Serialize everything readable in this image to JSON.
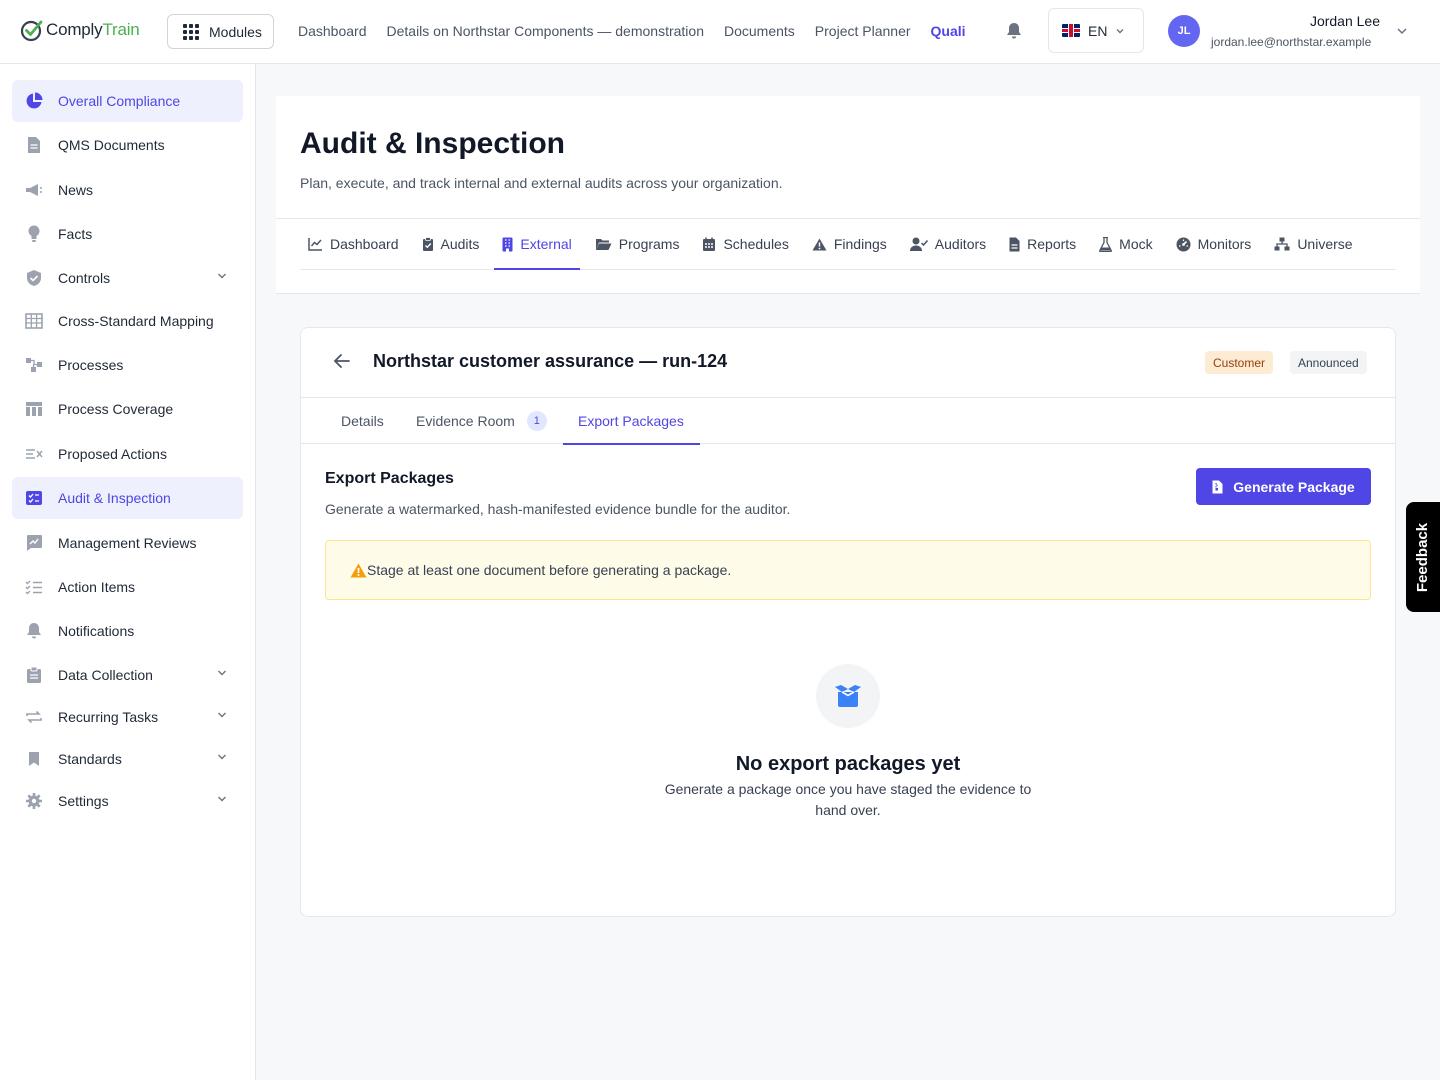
{
  "brand": {
    "name_part1": "Comply",
    "name_part2": "Train"
  },
  "topbar": {
    "modules_label": "Modules",
    "nav": [
      "Dashboard",
      "Details on Northstar Components — demonstration",
      "Documents",
      "Project Planner",
      "Quali"
    ],
    "active_nav": "Quali",
    "language": "EN",
    "user": {
      "initials": "JL",
      "name": "Jordan Lee",
      "email": "jordan.lee@northstar.example"
    }
  },
  "sidebar": {
    "items": [
      {
        "label": "Overall Compliance",
        "icon": "pie-chart-icon",
        "selected": true
      },
      {
        "label": "QMS Documents",
        "icon": "document-icon"
      },
      {
        "label": "News",
        "icon": "megaphone-icon"
      },
      {
        "label": "Facts",
        "icon": "lightbulb-icon"
      },
      {
        "label": "Controls",
        "icon": "shield-check-icon",
        "expandable": true
      },
      {
        "label": "Cross-Standard Mapping",
        "icon": "table-grid-icon"
      },
      {
        "label": "Processes",
        "icon": "process-flow-icon"
      },
      {
        "label": "Process Coverage",
        "icon": "table-columns-icon"
      },
      {
        "label": "Proposed Actions",
        "icon": "list-x-icon"
      },
      {
        "label": "Audit & Inspection",
        "icon": "clipboard-check-icon",
        "selected": true
      },
      {
        "label": "Management Reviews",
        "icon": "chart-comment-icon"
      },
      {
        "label": "Action Items",
        "icon": "checklist-icon"
      },
      {
        "label": "Notifications",
        "icon": "bell-icon"
      },
      {
        "label": "Data Collection",
        "icon": "clipboard-icon",
        "expandable": true
      },
      {
        "label": "Recurring Tasks",
        "icon": "repeat-icon",
        "expandable": true
      },
      {
        "label": "Standards",
        "icon": "bookmark-icon",
        "expandable": true
      },
      {
        "label": "Settings",
        "icon": "gear-icon",
        "expandable": true
      }
    ]
  },
  "page": {
    "title": "Audit & Inspection",
    "subtitle": "Plan, execute, and track internal and external audits across your organization.",
    "tabs": [
      {
        "label": "Dashboard",
        "icon": "line-chart-icon"
      },
      {
        "label": "Audits",
        "icon": "clipboard-check-icon"
      },
      {
        "label": "External",
        "icon": "building-icon",
        "selected": true
      },
      {
        "label": "Programs",
        "icon": "folder-open-icon"
      },
      {
        "label": "Schedules",
        "icon": "calendar-icon"
      },
      {
        "label": "Findings",
        "icon": "warning-icon"
      },
      {
        "label": "Auditors",
        "icon": "user-check-icon"
      },
      {
        "label": "Reports",
        "icon": "file-icon"
      },
      {
        "label": "Mock",
        "icon": "flask-icon"
      },
      {
        "label": "Monitors",
        "icon": "gauge-icon"
      },
      {
        "label": "Universe",
        "icon": "sitemap-icon"
      }
    ]
  },
  "audit": {
    "title": "Northstar customer assurance — run-124",
    "badges": {
      "type": "Customer",
      "status": "Announced"
    },
    "subtabs": {
      "details": "Details",
      "evidence": "Evidence Room",
      "evidence_count": "1",
      "export": "Export Packages"
    },
    "section_title": "Export Packages",
    "section_desc": "Generate a watermarked, hash-manifested evidence bundle for the auditor.",
    "generate_label": "Generate Package",
    "warning": "Stage at least one document before generating a package.",
    "empty_title": "No export packages yet",
    "empty_desc": "Generate a package once you have staged the evidence to hand over."
  },
  "feedback_label": "Feedback",
  "colors": {
    "accent": "#4f46e5",
    "brand_green": "#4caf50",
    "warning_bg": "#fefce8"
  }
}
